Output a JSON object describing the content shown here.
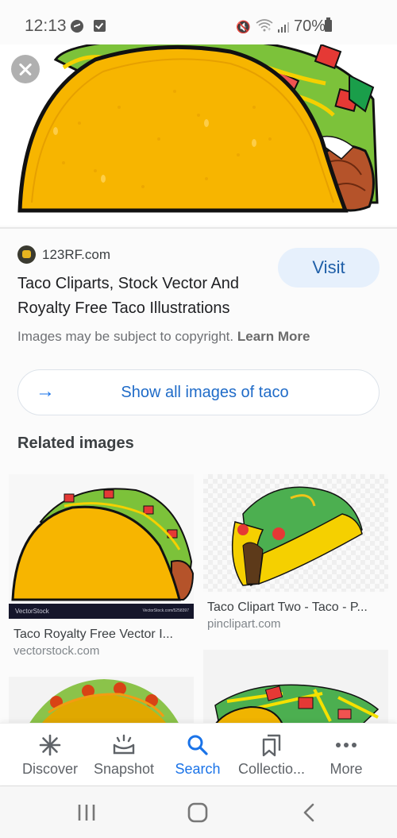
{
  "status_bar": {
    "time": "12:13",
    "notification_icons": [
      "messenger-icon",
      "check-box-icon"
    ],
    "system_icons": [
      "vibrate-mute-icon",
      "wifi-icon",
      "signal-icon",
      "battery-icon"
    ],
    "battery_percent": "70%"
  },
  "hero": {
    "image_alt": "Taco clipart",
    "close_label": "Close"
  },
  "result": {
    "source": "123RF.com",
    "title": "Taco Cliparts, Stock Vector And Royalty Free Taco Illustrations",
    "visit_label": "Visit",
    "copyright_text": "Images may be subject to copyright.",
    "learn_more_label": "Learn More"
  },
  "show_all": {
    "label": "Show all images of taco"
  },
  "related": {
    "heading": "Related images",
    "items": [
      {
        "title": "Taco Royalty Free Vector I...",
        "domain": "vectorstock.com",
        "watermark_left": "VectorStock",
        "watermark_right": "VectorStock.com/5258397"
      },
      {
        "title": "Taco Clipart Two - Taco - P...",
        "domain": "pinclipart.com"
      },
      {
        "title": "",
        "domain": ""
      },
      {
        "title": "",
        "domain": ""
      }
    ]
  },
  "bottom_nav": {
    "items": [
      {
        "label": "Discover",
        "icon": "asterisk-icon",
        "active": false
      },
      {
        "label": "Snapshot",
        "icon": "snapshot-icon",
        "active": false
      },
      {
        "label": "Search",
        "icon": "search-icon",
        "active": true
      },
      {
        "label": "Collectio...",
        "icon": "collections-icon",
        "active": false
      },
      {
        "label": "More",
        "icon": "more-dots-icon",
        "active": false
      }
    ]
  },
  "colors": {
    "accent": "#1a73e8",
    "visit_bg": "#e6f0fc",
    "text_primary": "#202124",
    "text_secondary": "#6f7175"
  }
}
